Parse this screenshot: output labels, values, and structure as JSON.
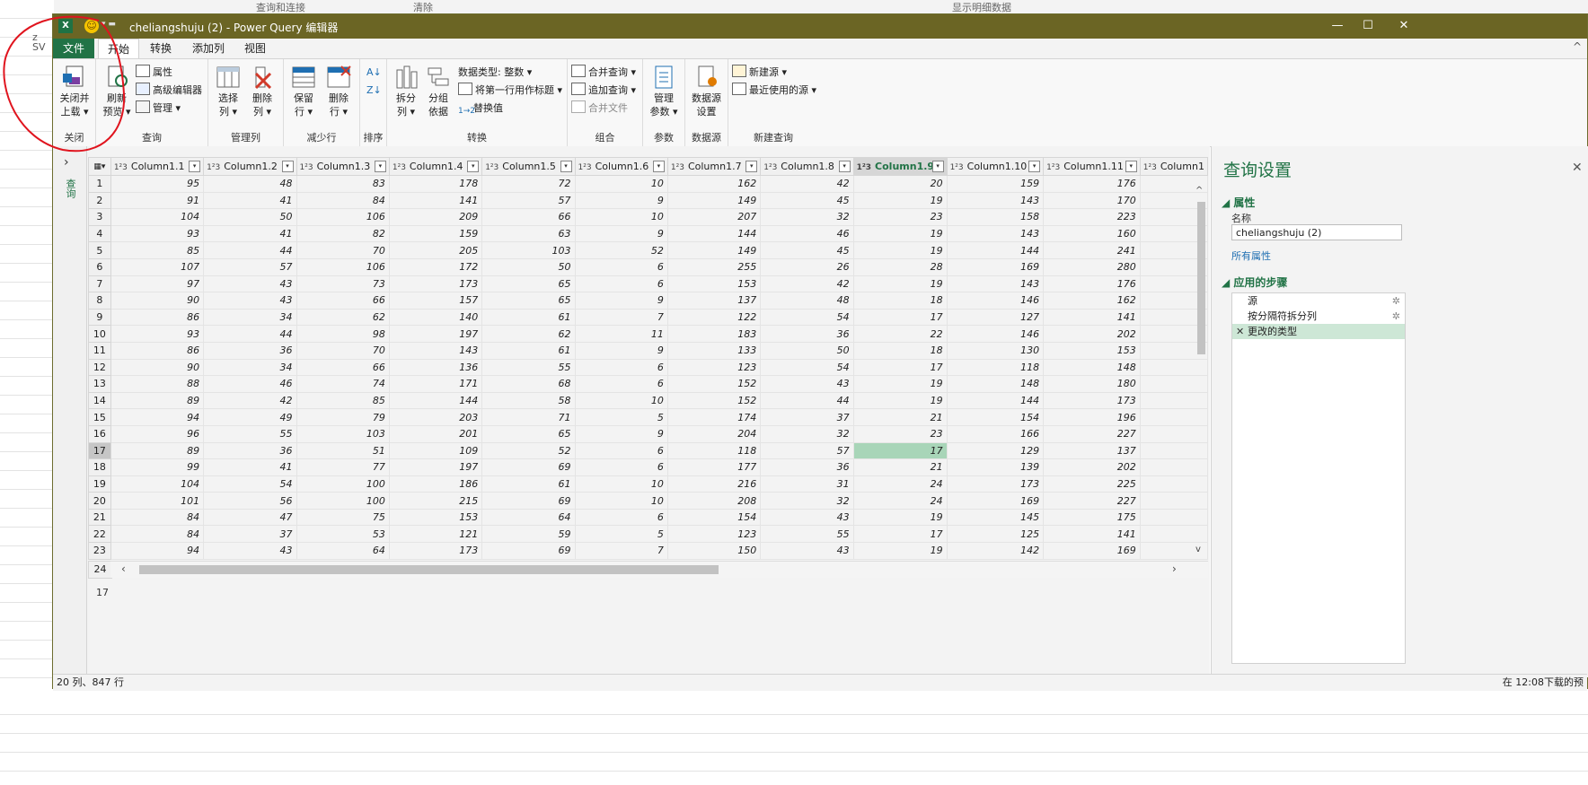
{
  "window": {
    "title": "cheliangshuju (2) - Power Query 编辑器",
    "excel_icon": "X",
    "minimize": "—",
    "maximize": "☐",
    "close": "✕"
  },
  "background": {
    "strip_items": [
      "查询和连接",
      "清除",
      "显示明细数据"
    ],
    "left_text": "z\nSV"
  },
  "menu": {
    "file": "文件",
    "tabs": [
      "开始",
      "转换",
      "添加列",
      "视图"
    ]
  },
  "ribbon": {
    "close_group": {
      "label": "关闭",
      "close_load": "关闭并\n上载 ▾"
    },
    "query_group": {
      "label": "查询",
      "refresh": "刷新\n预览 ▾",
      "properties": "属性",
      "advanced_editor": "高级编辑器",
      "manage": "管理 ▾"
    },
    "manage_cols_group": {
      "label": "管理列",
      "choose_cols": "选择\n列 ▾",
      "remove_cols": "删除\n列 ▾"
    },
    "reduce_rows_group": {
      "label": "减少行",
      "keep_rows": "保留\n行 ▾",
      "remove_rows": "删除\n行 ▾"
    },
    "sort_group": {
      "label": "排序"
    },
    "transform_group": {
      "label": "转换",
      "split_col": "拆分\n列 ▾",
      "group_by": "分组\n依据",
      "data_type": "数据类型: 整数 ▾",
      "first_row_header": "将第一行用作标题 ▾",
      "replace_values": "替换值"
    },
    "combine_group": {
      "label": "组合",
      "merge_queries": "合并查询 ▾",
      "append_queries": "追加查询 ▾",
      "combine_files": "合并文件"
    },
    "params_group": {
      "label": "参数",
      "manage_params": "管理\n参数 ▾"
    },
    "datasource_group": {
      "label": "数据源",
      "ds_settings": "数据源\n设置"
    },
    "newquery_group": {
      "label": "新建查询",
      "new_source": "新建源 ▾",
      "recent_sources": "最近使用的源 ▾"
    }
  },
  "left_pane": {
    "label": "查询"
  },
  "grid": {
    "columns": [
      "Column1.1",
      "Column1.2",
      "Column1.3",
      "Column1.4",
      "Column1.5",
      "Column1.6",
      "Column1.7",
      "Column1.8",
      "Column1.9",
      "Column1.10",
      "Column1.11",
      "Column1"
    ],
    "type_icon": "1²3",
    "selected_column": "Column1.9",
    "selected_row": 17,
    "rows": [
      [
        95,
        48,
        83,
        178,
        72,
        10,
        162,
        42,
        20,
        159,
        176
      ],
      [
        91,
        41,
        84,
        141,
        57,
        9,
        149,
        45,
        19,
        143,
        170
      ],
      [
        104,
        50,
        106,
        209,
        66,
        10,
        207,
        32,
        23,
        158,
        223
      ],
      [
        93,
        41,
        82,
        159,
        63,
        9,
        144,
        46,
        19,
        143,
        160
      ],
      [
        85,
        44,
        70,
        205,
        103,
        52,
        149,
        45,
        19,
        144,
        241
      ],
      [
        107,
        57,
        106,
        172,
        50,
        6,
        255,
        26,
        28,
        169,
        280
      ],
      [
        97,
        43,
        73,
        173,
        65,
        6,
        153,
        42,
        19,
        143,
        176
      ],
      [
        90,
        43,
        66,
        157,
        65,
        9,
        137,
        48,
        18,
        146,
        162
      ],
      [
        86,
        34,
        62,
        140,
        61,
        7,
        122,
        54,
        17,
        127,
        141
      ],
      [
        93,
        44,
        98,
        197,
        62,
        11,
        183,
        36,
        22,
        146,
        202
      ],
      [
        86,
        36,
        70,
        143,
        61,
        9,
        133,
        50,
        18,
        130,
        153
      ],
      [
        90,
        34,
        66,
        136,
        55,
        6,
        123,
        54,
        17,
        118,
        148
      ],
      [
        88,
        46,
        74,
        171,
        68,
        6,
        152,
        43,
        19,
        148,
        180
      ],
      [
        89,
        42,
        85,
        144,
        58,
        10,
        152,
        44,
        19,
        144,
        173
      ],
      [
        94,
        49,
        79,
        203,
        71,
        5,
        174,
        37,
        21,
        154,
        196
      ],
      [
        96,
        55,
        103,
        201,
        65,
        9,
        204,
        32,
        23,
        166,
        227
      ],
      [
        89,
        36,
        51,
        109,
        52,
        6,
        118,
        57,
        17,
        129,
        137
      ],
      [
        99,
        41,
        77,
        197,
        69,
        6,
        177,
        36,
        21,
        139,
        202
      ],
      [
        104,
        54,
        100,
        186,
        61,
        10,
        216,
        31,
        24,
        173,
        225
      ],
      [
        101,
        56,
        100,
        215,
        69,
        10,
        208,
        32,
        24,
        169,
        227
      ],
      [
        84,
        47,
        75,
        153,
        64,
        6,
        154,
        43,
        19,
        145,
        175
      ],
      [
        84,
        37,
        53,
        121,
        59,
        5,
        123,
        55,
        17,
        125,
        141
      ],
      [
        94,
        43,
        64,
        173,
        69,
        7,
        150,
        43,
        19,
        142,
        169
      ]
    ],
    "last_row_number": "24",
    "selected_value_display": "17"
  },
  "settings": {
    "title": "查询设置",
    "properties_heading": "属性",
    "name_label": "名称",
    "name_value": "cheliangshuju (2)",
    "all_properties": "所有属性",
    "steps_heading": "应用的步骤",
    "steps": [
      "源",
      "按分隔符拆分列",
      "更改的类型"
    ]
  },
  "status": {
    "left": "20 列、847 行",
    "right": "在 12:08下载的预"
  }
}
